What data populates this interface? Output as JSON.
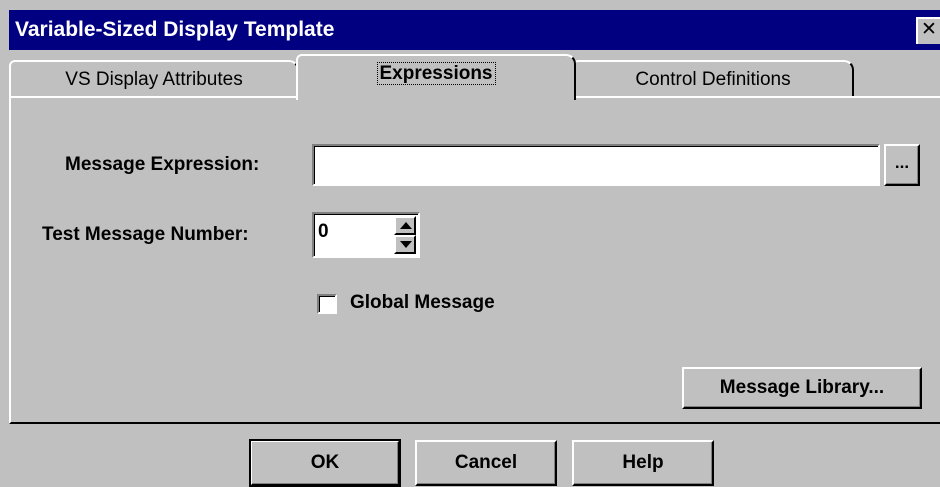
{
  "window": {
    "title": "Variable-Sized Display Template",
    "close_glyph": "✕"
  },
  "tabs": [
    {
      "label": "VS Display Attributes",
      "active": false
    },
    {
      "label": "Expressions",
      "active": true
    },
    {
      "label": "Control Definitions",
      "active": false
    }
  ],
  "form": {
    "message_expression_label": "Message Expression:",
    "message_expression_value": "",
    "browse_label": "...",
    "test_message_number_label": "Test Message Number:",
    "test_message_number_value": "0",
    "global_message_label": "Global Message",
    "global_message_checked": false,
    "message_library_label": "Message Library..."
  },
  "buttons": {
    "ok": "OK",
    "cancel": "Cancel",
    "help": "Help"
  },
  "colors": {
    "title_bar": "#000080",
    "face": "#c0c0c0",
    "highlight": "#ffffff",
    "shadow": "#808080"
  }
}
